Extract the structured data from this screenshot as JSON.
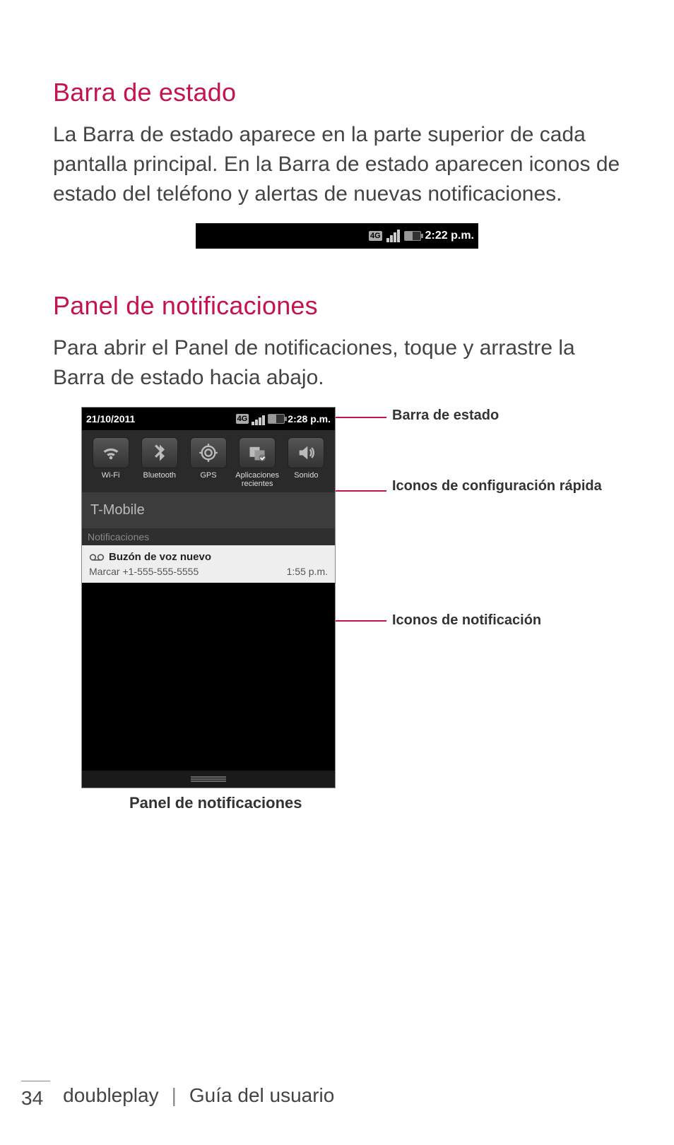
{
  "section1": {
    "title": "Barra de estado",
    "paragraph": "La Barra de estado aparece en la parte superior de cada pantalla principal. En la Barra de estado aparecen iconos de estado del teléfono y alertas de nuevas notificaciones."
  },
  "statusbar": {
    "fourG": "4G",
    "time": "2:22 p.m."
  },
  "section2": {
    "title": "Panel de notificaciones",
    "paragraph": "Para abrir el Panel de notificaciones, toque y arrastre la Barra de estado hacia abajo."
  },
  "phone": {
    "date": "21/10/2011",
    "fourG": "4G",
    "time": "2:28 p.m.",
    "quick": {
      "wifi": "Wi-Fi",
      "bluetooth": "Bluetooth",
      "gps": "GPS",
      "recent": "Aplicaciones recientes",
      "sound": "Sonido"
    },
    "carrier": "T-Mobile",
    "sectionLabel": "Notificaciones",
    "notification": {
      "title": "Buzón de voz nuevo",
      "subtitle": "Marcar +1-555-555-5555",
      "time": "1:55 p.m."
    }
  },
  "callouts": {
    "c1": "Barra de estado",
    "c2": "Iconos de configuración rápida",
    "c3": "Iconos de notificación",
    "caption": "Panel de notificaciones"
  },
  "footer": {
    "page": "34",
    "product": "doubleplay",
    "sep": "|",
    "guide": "Guía del usuario"
  }
}
